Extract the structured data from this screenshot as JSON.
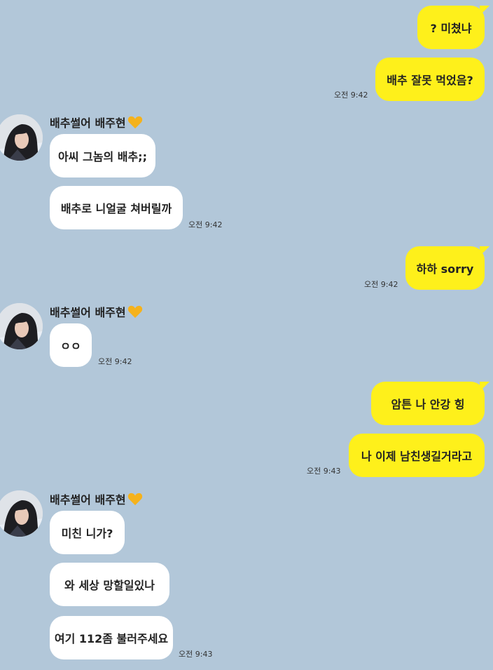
{
  "colors": {
    "background": "#b2c7d9",
    "my_bubble": "#fef01b",
    "their_bubble": "#ffffff",
    "heart": "#f5b21c"
  },
  "sender_name": "배추썰어 배주현",
  "messages": {
    "m1": "? 미쳤냐",
    "m2": "배추 잘못 먹었음?",
    "m3": "아씨 그놈의 배추;;",
    "m4": "배추로 니얼굴 쳐버릴까",
    "m5": "하하 sorry",
    "m6": "ㅇㅇ",
    "m7": "암튼 나 안강 힝",
    "m8": "나 이제 남친생길거라고",
    "m9": "미친 니가?",
    "m10": "와 세상 망할일있나",
    "m11": "여기 112좀 불러주세요"
  },
  "times": {
    "t1": "오전 9:42",
    "t2": "오전 9:42",
    "t3": "오전 9:42",
    "t4": "오전 9:42",
    "t5": "오전 9:43",
    "t6": "오전 9:43"
  },
  "icons": [
    "avatar",
    "heart-icon",
    "pout-emoticon-icon"
  ]
}
